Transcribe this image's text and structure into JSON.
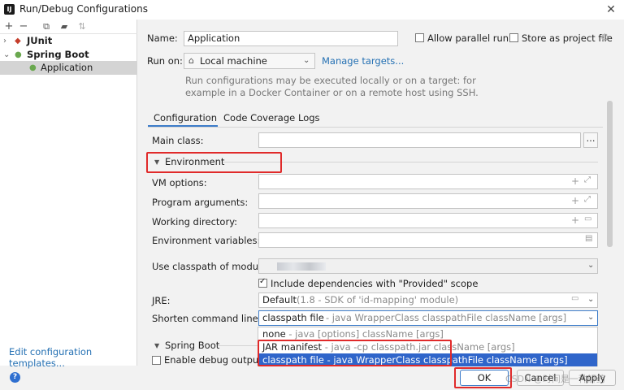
{
  "window": {
    "title": "Run/Debug Configurations",
    "app_icon": "IJ"
  },
  "tree": {
    "items": [
      {
        "label": "JUnit",
        "icon": "junit-icon"
      },
      {
        "label": "Spring Boot",
        "icon": "spring-boot-icon"
      },
      {
        "label": "Application",
        "icon": "app-config-icon"
      }
    ]
  },
  "left_footer": {
    "edit_templates": "Edit configuration templates..."
  },
  "config": {
    "name_label": "Name:",
    "name_value": "Application",
    "allow_parallel": "Allow parallel run",
    "store_project": "Store as project file",
    "run_on_label": "Run on:",
    "run_on_value": "Local machine",
    "manage_targets": "Manage targets...",
    "description_line1": "Run configurations may be executed locally or on a target: for",
    "description_line2": "example in a Docker Container or on a remote host using SSH."
  },
  "tabs": [
    "Configuration",
    "Code Coverage",
    "Logs"
  ],
  "form": {
    "main_class": "Main class:",
    "environment": "Environment",
    "vm_options": "VM options:",
    "program_args": "Program arguments:",
    "working_dir": "Working directory:",
    "env_vars": "Environment variables:",
    "classpath_module": "Use classpath of module:",
    "include_deps": "Include dependencies with \"Provided\" scope",
    "jre_label": "JRE:",
    "jre_value": "Default",
    "jre_hint": "(1.8 - SDK of 'id-mapping' module)",
    "shorten_label": "Shorten command line:",
    "shorten_value": "classpath file",
    "shorten_hint": "- java WrapperClass classpathFile className [args]",
    "spring_boot_section": "Spring Boot",
    "enable_debug": "Enable debug output"
  },
  "shorten_options": [
    {
      "label": "none",
      "hint": "- java [options] className [args]"
    },
    {
      "label": "JAR manifest",
      "hint": "- java -cp classpath.jar className [args]"
    },
    {
      "label": "classpath file",
      "hint": "- java WrapperClass classpathFile className [args]"
    }
  ],
  "buttons": {
    "ok": "OK",
    "cancel": "Cancel",
    "apply": "Apply"
  },
  "watermark": "CSDN @时间是一种解药",
  "colors": {
    "accent": "#2f65ca",
    "link": "#2470b3",
    "highlight_box": "#e02a2a"
  }
}
